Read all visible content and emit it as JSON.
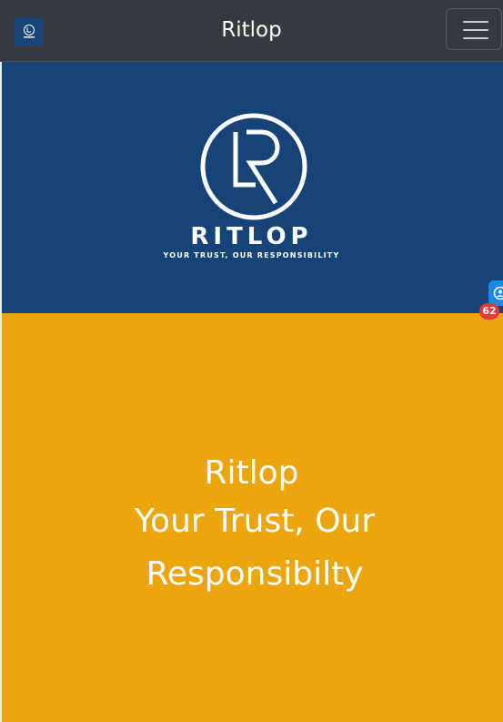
{
  "navbar": {
    "title": "Ritlop",
    "logo_icon": "ritlop-logo-icon",
    "toggle_icon": "hamburger-menu-icon"
  },
  "banner": {
    "brand_word": "RITLOP",
    "tagline": "YOUR TRUST, OUR RESPONSIBILITY",
    "logo_icon": "ritlop-lr-monogram-icon"
  },
  "hero": {
    "title": "Ritlop",
    "subtitle": "Your Trust, Our Responsibilty"
  },
  "widget": {
    "icon": "chat-support-icon",
    "badge_count": "62"
  },
  "colors": {
    "navbar": "#343a40",
    "banner": "#174478",
    "hero": "#eba50d",
    "badge": "#e53935",
    "widget": "#1e88e5"
  }
}
